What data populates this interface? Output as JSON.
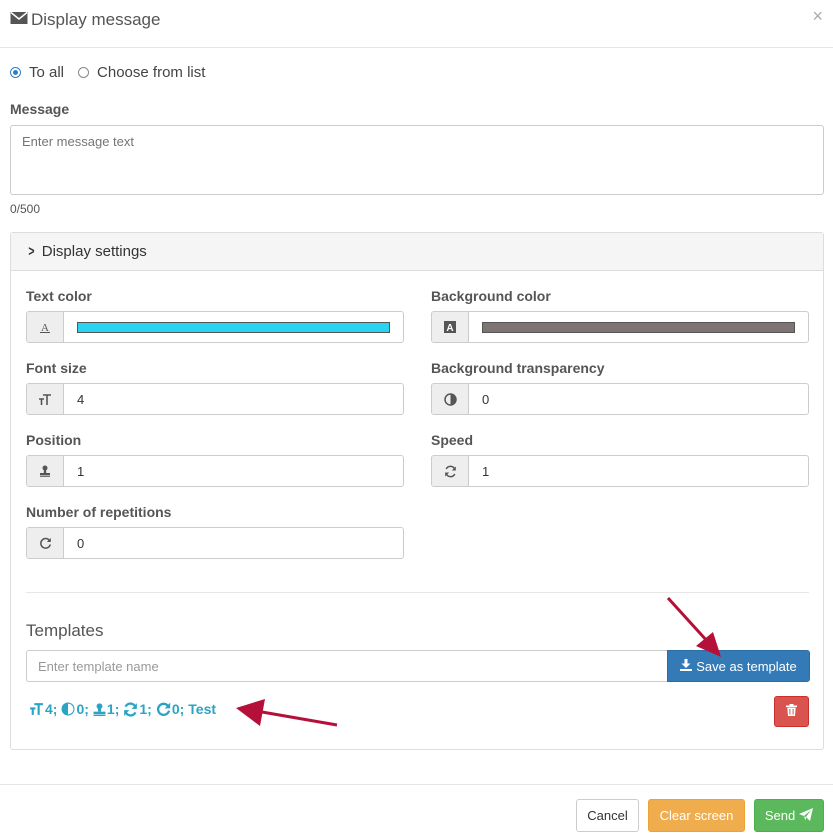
{
  "dialog": {
    "title": "Display message",
    "close_symbol": "×"
  },
  "recipients": {
    "options": [
      {
        "label": "To all",
        "checked": true
      },
      {
        "label": "Choose from list",
        "checked": false
      }
    ]
  },
  "message": {
    "label": "Message",
    "placeholder": "Enter message text",
    "counter": "0/500"
  },
  "display_settings": {
    "header": "Display settings",
    "text_color": {
      "label": "Text color",
      "value": "#2ad4f0"
    },
    "background_color": {
      "label": "Background color",
      "value": "#7f7474"
    },
    "font_size": {
      "label": "Font size",
      "value": "4"
    },
    "background_transparency": {
      "label": "Background transparency",
      "value": "0"
    },
    "position": {
      "label": "Position",
      "value": "1"
    },
    "speed": {
      "label": "Speed",
      "value": "1"
    },
    "repetitions": {
      "label": "Number of repetitions",
      "value": "0"
    }
  },
  "templates": {
    "title": "Templates",
    "input_placeholder": "Enter template name",
    "save_label": "Save as template",
    "items": [
      {
        "font_size": "4;",
        "transparency": "0;",
        "position": "1;",
        "speed": "1;",
        "repetitions": "0;",
        "name": "Test"
      }
    ]
  },
  "footer": {
    "cancel": "Cancel",
    "clear": "Clear screen",
    "send": "Send"
  },
  "colors": {
    "primary": "#337ab7",
    "danger": "#d9534f",
    "warning": "#f0ad4e",
    "success": "#5cb85c",
    "template_text": "#2ba3c4",
    "annotation_arrow": "#b5103a"
  }
}
